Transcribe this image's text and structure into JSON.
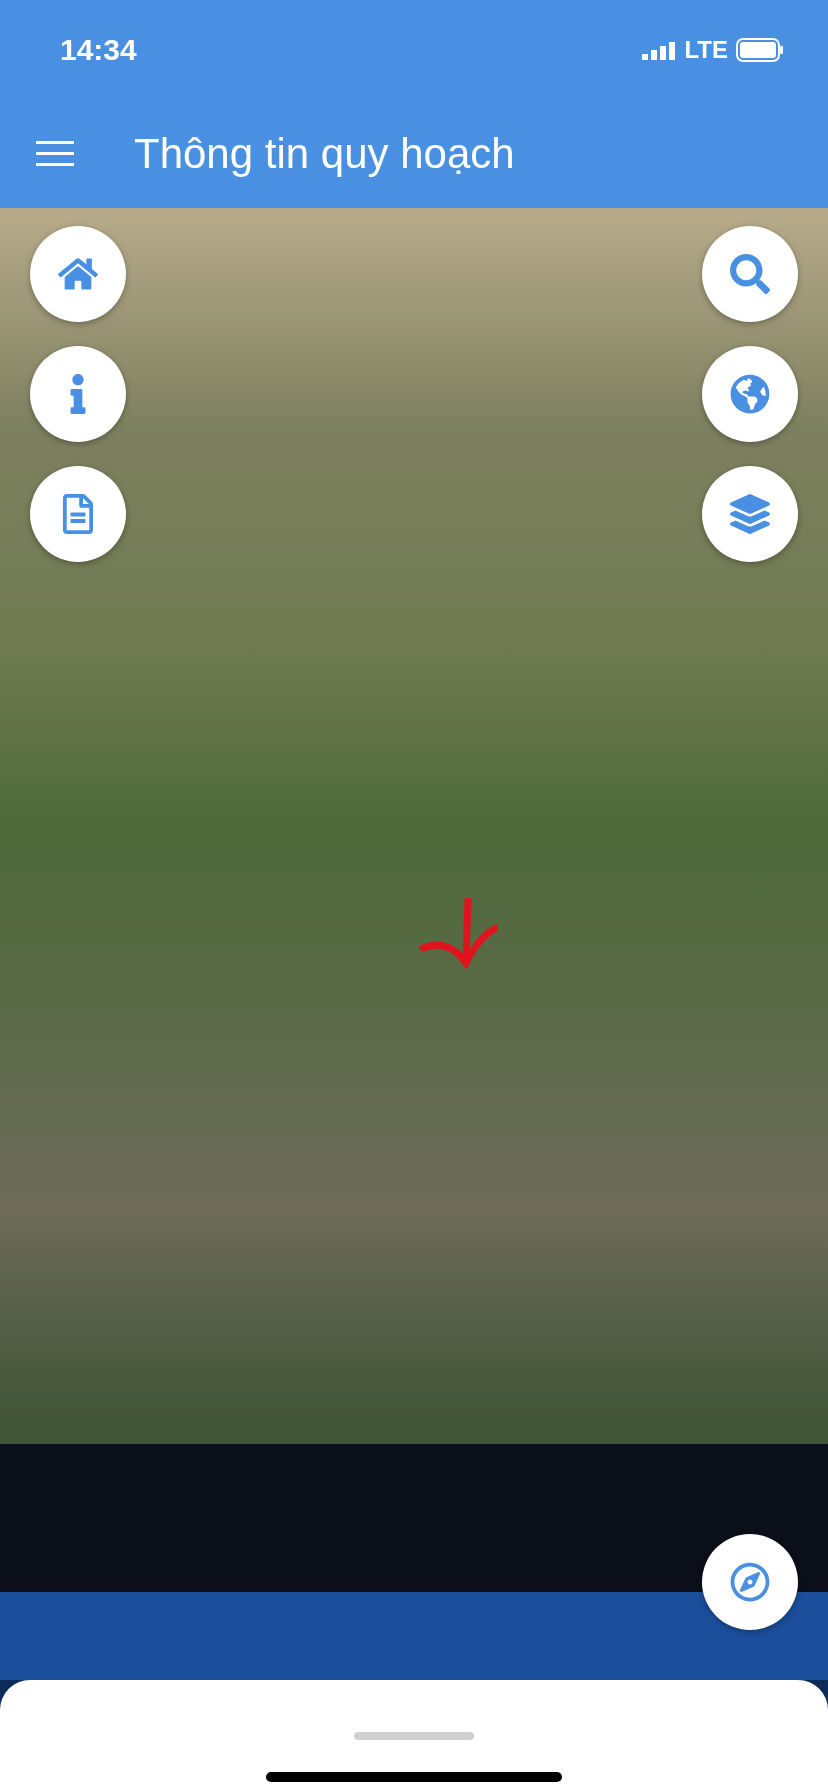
{
  "status_bar": {
    "time": "14:34",
    "network": "LTE"
  },
  "header": {
    "title": "Thông tin quy hoạch"
  }
}
